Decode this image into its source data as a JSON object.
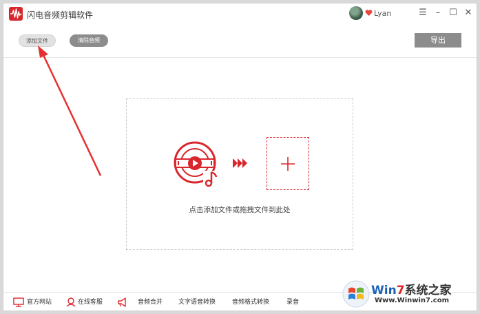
{
  "window": {
    "title": "闪电音频剪辑软件"
  },
  "user": {
    "name": "Lyan"
  },
  "controls": {
    "menu": "☰",
    "minimize": "–",
    "maximize": "☐",
    "close": "✕"
  },
  "toolbar": {
    "add_file": "添加文件",
    "clear_audio": "清除音频",
    "export": "导出"
  },
  "dropzone": {
    "hint": "点击添加文件或拖拽文件到此处"
  },
  "footer": {
    "items": [
      {
        "label": "官方网站",
        "icon": "monitor-icon"
      },
      {
        "label": "在线客服",
        "icon": "support-icon"
      },
      {
        "label": "音频合并",
        "icon": "megaphone-icon"
      },
      {
        "label": "文字语音转换"
      },
      {
        "label": "音频格式转换"
      },
      {
        "label": "录音"
      }
    ]
  },
  "watermark": {
    "brand_prefix": "Win",
    "brand_seven": "7",
    "brand_zh": "系统之家",
    "url": "Www.Winwin7.com"
  },
  "colors": {
    "accent": "#d9262c",
    "button_gray": "#8c8c8c",
    "annotation_arrow": "#e53030"
  }
}
